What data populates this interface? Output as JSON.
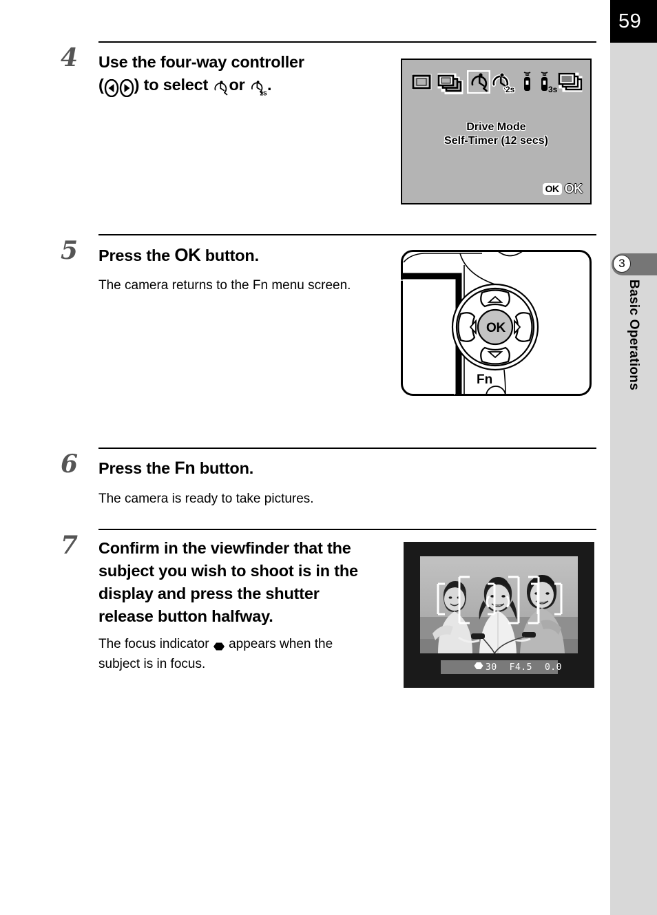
{
  "page": {
    "number": "59",
    "chapter_number": "3",
    "chapter_title": "Basic Operations",
    "background": "#ffffff",
    "sidebar_color": "#d8d8d8",
    "tab_color": "#767676"
  },
  "steps": [
    {
      "number": "4",
      "heading_part1": "Use the four-way controller",
      "heading_paren_open": "(",
      "heading_arrow_left_icon": "four-way-left-button-icon",
      "heading_arrow_right_icon": "four-way-right-button-icon",
      "heading_paren_close": ") to select",
      "heading_selftimer_12s_icon": "self-timer-12s-icon",
      "heading_or": "or",
      "heading_selftimer_2s_icon": "self-timer-2s-icon",
      "heading_period": ".",
      "body": ""
    },
    {
      "number": "5",
      "heading_prefix": "Press the",
      "heading_ok": "OK",
      "heading_suffix": "button.",
      "body": "The camera returns to the Fn menu screen."
    },
    {
      "number": "6",
      "heading_prefix": "Press the",
      "heading_fn": "Fn",
      "heading_suffix": "button.",
      "body": "The camera is ready to take pictures."
    },
    {
      "number": "7",
      "heading": "Confirm in the viewfinder that the subject you wish to shoot is in the display and press the shutter release button halfway.",
      "body_part1": "The focus indicator",
      "body_focus_icon": "focus-indicator-icon",
      "body_part2": "appears when the subject is in focus."
    }
  ],
  "lcd_screen": {
    "screen_bg": "#b4b4b4",
    "drive_mode_icons": [
      {
        "name": "single-frame-icon",
        "label": "Single Frame",
        "selected": false
      },
      {
        "name": "continuous-shooting-icon",
        "label": "Continuous",
        "selected": false
      },
      {
        "name": "self-timer-12s-icon",
        "label": "Self-Timer 12 secs",
        "selected": true
      },
      {
        "name": "self-timer-2s-icon",
        "label": "Self-Timer 2 secs",
        "selected": false,
        "sub": "2s"
      },
      {
        "name": "remote-control-icon",
        "label": "Remote Control",
        "selected": false
      },
      {
        "name": "remote-control-3s-icon",
        "label": "Remote Control 3 secs",
        "selected": false,
        "sub": "3s"
      },
      {
        "name": "exposure-bracketing-icon",
        "label": "Exposure Bracketing",
        "selected": false
      }
    ],
    "caption_line1": "Drive Mode",
    "caption_line2": "Self-Timer (12 secs)",
    "ok_badge": "OK",
    "ok_label": "OK"
  },
  "controller_figure": {
    "ok_button_label": "OK",
    "fn_button_label": "Fn",
    "up_icon": "arrow-up-icon",
    "down_icon": "arrow-down-icon",
    "left_icon": "arrow-left-icon",
    "right_icon": "arrow-right-icon"
  },
  "viewfinder": {
    "focus_indicator_icon": "focus-indicator-icon",
    "shutter_speed": "30",
    "aperture": "F4.5",
    "exposure_compensation": "0.0",
    "flash_icon": "flash-ready-icon",
    "af_frames": 3
  }
}
